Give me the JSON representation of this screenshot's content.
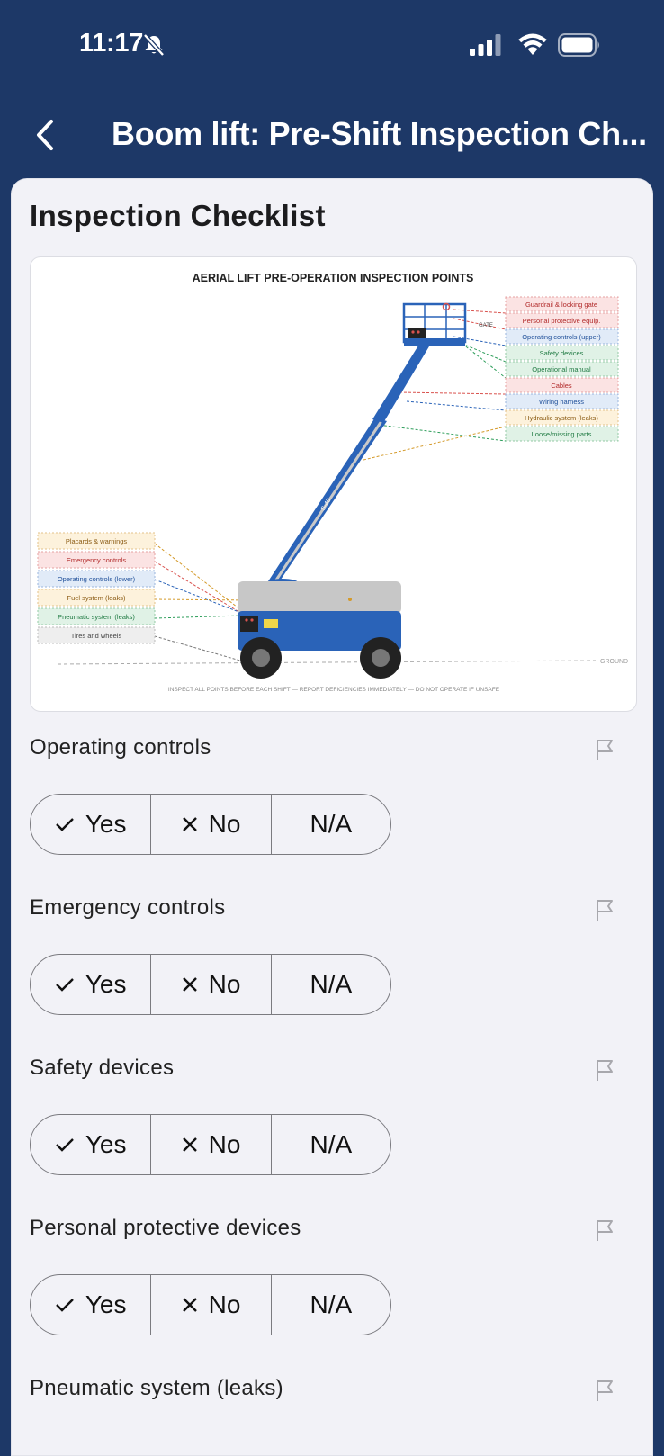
{
  "status": {
    "time": "11:17"
  },
  "nav": {
    "title": "Boom lift: Pre-Shift Inspection Ch..."
  },
  "section": {
    "title": "Inspection Checklist"
  },
  "diagram": {
    "title": "AERIAL LIFT PRE-OPERATION INSPECTION POINTS",
    "right_labels": [
      "Guardrail & locking gate",
      "Personal protective equip.",
      "Operating controls (upper)",
      "Safety devices",
      "Operational manual",
      "Cables",
      "Wiring harness",
      "Hydraulic system (leaks)",
      "Loose/missing parts"
    ],
    "left_labels": [
      "Placards & warnings",
      "Emergency controls",
      "Operating controls (lower)",
      "Fuel system (leaks)",
      "Pneumatic system (leaks)",
      "Tires and wheels"
    ],
    "gate_label": "GATE",
    "ground_label": "GROUND",
    "footer": "INSPECT ALL POINTS BEFORE EACH SHIFT — REPORT DEFICIENCIES IMMEDIATELY — DO NOT OPERATE IF UNSAFE",
    "boom_label": "S-40"
  },
  "options": {
    "yes": "Yes",
    "no": "No",
    "na": "N/A"
  },
  "questions": [
    {
      "label": "Operating controls"
    },
    {
      "label": "Emergency controls"
    },
    {
      "label": "Safety devices"
    },
    {
      "label": "Personal protective devices"
    },
    {
      "label": "Pneumatic system (leaks)"
    }
  ],
  "colors": {
    "header": "#1d3867",
    "background": "#f2f2f7",
    "lift_blue": "#2a63b8"
  }
}
